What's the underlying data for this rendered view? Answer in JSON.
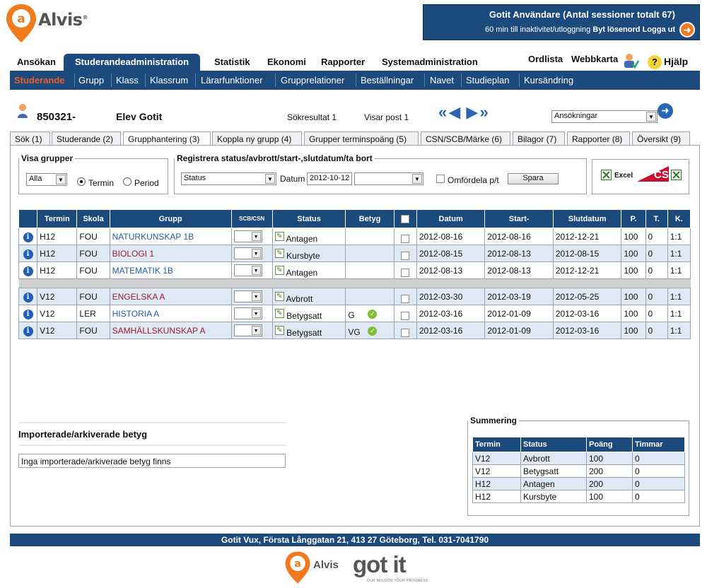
{
  "brand": {
    "name": "Alvis",
    "trademark": "®",
    "partner": "got it",
    "partner_tagline": "OUR MISSION YOUR PROGRESS"
  },
  "user_box": {
    "title": "Gotit Användare (Antal sessioner totalt 67)",
    "timeout": "60 min till inaktivitet/utloggning",
    "change_pw": "Byt lösenord",
    "logout": "Logga ut"
  },
  "main_menu": [
    "Ansökan",
    "Studerandeadministration",
    "Statistik",
    "Ekonomi",
    "Rapporter",
    "Systemadministration"
  ],
  "top_links": {
    "glossary": "Ordlista",
    "sitemap": "Webbkarta",
    "help": "Hjälp",
    "help_icon_text": "?"
  },
  "sub_menu": [
    "Studerande",
    "Grupp",
    "Klass",
    "Klassrum",
    "Lärarfunktioner",
    "Grupprelationer",
    "Beställningar",
    "Navet",
    "Studieplan",
    "Kursändring"
  ],
  "student": {
    "id": "850321-",
    "name": "Elev Gotit"
  },
  "search": {
    "result": "Sökresultat 1",
    "showing": "Visar post 1",
    "select_value": "Ansökningar"
  },
  "tabs": [
    "Sök (1)",
    "Studerande (2)",
    "Grupphantering (3)",
    "Koppla ny grupp (4)",
    "Grupper terminspoäng (5)",
    "CSN/SCB/Märke (6)",
    "Bilagor (7)",
    "Rapporter (8)",
    "Översikt (9)"
  ],
  "visa_grupper": {
    "legend": "Visa grupper",
    "select": "Alla",
    "opt_termin": "Termin",
    "opt_period": "Period"
  },
  "register": {
    "legend": "Registrera status/avbrott/start-,slutdatum/ta bort",
    "status_select": "Status",
    "date_label": "Datum",
    "date_value": "2012-10-12",
    "redistribute": "Omfördela p/t",
    "save": "Spara"
  },
  "exports": {
    "excel": "Excel",
    "csn": "CSN"
  },
  "table": {
    "headers": [
      "",
      "Termin",
      "Skola",
      "Grupp",
      "SCB/CSN",
      "Status",
      "Betyg",
      "",
      "Datum",
      "Start-",
      "Slutdatum",
      "P.",
      "T.",
      "K."
    ],
    "rows": [
      {
        "termin": "H12",
        "skola": "FOU",
        "grupp": "NATURKUNSKAP 1B",
        "grupp_color": "blue",
        "status": "Antagen",
        "betyg": "",
        "datum": "2012-08-16",
        "start": "2012-08-16",
        "slut": "2012-12-21",
        "p": "100",
        "t": "0",
        "k": "1:1"
      },
      {
        "termin": "H12",
        "skola": "FOU",
        "grupp": "BIOLOGI 1",
        "grupp_color": "red",
        "status": "Kursbyte",
        "betyg": "",
        "datum": "2012-08-15",
        "start": "2012-08-13",
        "slut": "2012-08-15",
        "p": "100",
        "t": "0",
        "k": "1:1"
      },
      {
        "termin": "H12",
        "skola": "FOU",
        "grupp": "MATEMATIK 1B",
        "grupp_color": "blue",
        "status": "Antagen",
        "betyg": "",
        "datum": "2012-08-13",
        "start": "2012-08-13",
        "slut": "2012-12-21",
        "p": "100",
        "t": "0",
        "k": "1:1"
      },
      {
        "termin": "V12",
        "skola": "FOU",
        "grupp": "ENGELSKA A",
        "grupp_color": "red",
        "status": "Avbrott",
        "betyg": "",
        "datum": "2012-03-30",
        "start": "2012-03-19",
        "slut": "2012-05-25",
        "p": "100",
        "t": "0",
        "k": "1:1"
      },
      {
        "termin": "V12",
        "skola": "LER",
        "grupp": "HISTORIA A",
        "grupp_color": "blue",
        "status": "Betygsatt",
        "betyg": "G",
        "datum": "2012-03-16",
        "start": "2012-01-09",
        "slut": "2012-03-16",
        "p": "100",
        "t": "0",
        "k": "1:1"
      },
      {
        "termin": "V12",
        "skola": "FOU",
        "grupp": "SAMHÄLLSKUNSKAP A",
        "grupp_color": "red",
        "status": "Betygsatt",
        "betyg": "VG",
        "datum": "2012-03-16",
        "start": "2012-01-09",
        "slut": "2012-03-16",
        "p": "100",
        "t": "0",
        "k": "1:1"
      }
    ]
  },
  "imported": {
    "title": "Importerade/arkiverade betyg",
    "empty": "Inga importerade/arkiverade betyg finns"
  },
  "summary": {
    "legend": "Summering",
    "headers": [
      "Termin",
      "Status",
      "Poäng",
      "Timmar"
    ],
    "rows": [
      [
        "V12",
        "Avbrott",
        "100",
        "0"
      ],
      [
        "V12",
        "Betygsatt",
        "200",
        "0"
      ],
      [
        "H12",
        "Antagen",
        "200",
        "0"
      ],
      [
        "H12",
        "Kursbyte",
        "100",
        "0"
      ]
    ]
  },
  "footer": "Gotit Vux, Första Långgatan 21, 413 27 Göteborg, Tel. 031-7041790",
  "colors": {
    "navy": "#1d4a7d",
    "accent": "#f05a28",
    "row_alt": "#dfe9f6"
  }
}
